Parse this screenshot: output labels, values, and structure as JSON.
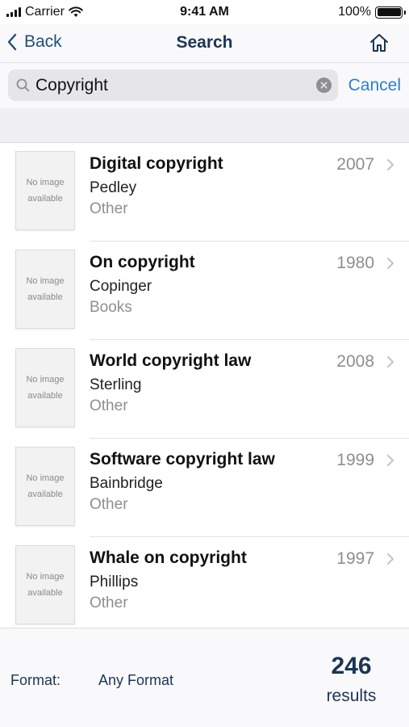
{
  "status_bar": {
    "carrier": "Carrier",
    "time": "9:41 AM",
    "battery": "100%"
  },
  "nav": {
    "back_label": "Back",
    "title": "Search"
  },
  "search": {
    "query": "Copyright",
    "cancel_label": "Cancel"
  },
  "results": [
    {
      "title": "Digital copyright",
      "author": "Pedley",
      "format": "Other",
      "year": "2007",
      "thumb_line1": "No image",
      "thumb_line2": "available"
    },
    {
      "title": "On copyright",
      "author": "Copinger",
      "format": "Books",
      "year": "1980",
      "thumb_line1": "No image",
      "thumb_line2": "available"
    },
    {
      "title": "World copyright law",
      "author": "Sterling",
      "format": "Other",
      "year": "2008",
      "thumb_line1": "No image",
      "thumb_line2": "available"
    },
    {
      "title": "Software copyright law",
      "author": "Bainbridge",
      "format": "Other",
      "year": "1999",
      "thumb_line1": "No image",
      "thumb_line2": "available"
    },
    {
      "title": "Whale on copyright",
      "author": "Phillips",
      "format": "Other",
      "year": "1997",
      "thumb_line1": "No image",
      "thumb_line2": "available"
    }
  ],
  "footer": {
    "format_label": "Format:",
    "format_value": "Any Format",
    "count": "246",
    "results_label": "results"
  },
  "colors": {
    "accent": "#2a7fd4",
    "nav_text": "#1c3553",
    "secondary_text": "#8e8e93"
  }
}
